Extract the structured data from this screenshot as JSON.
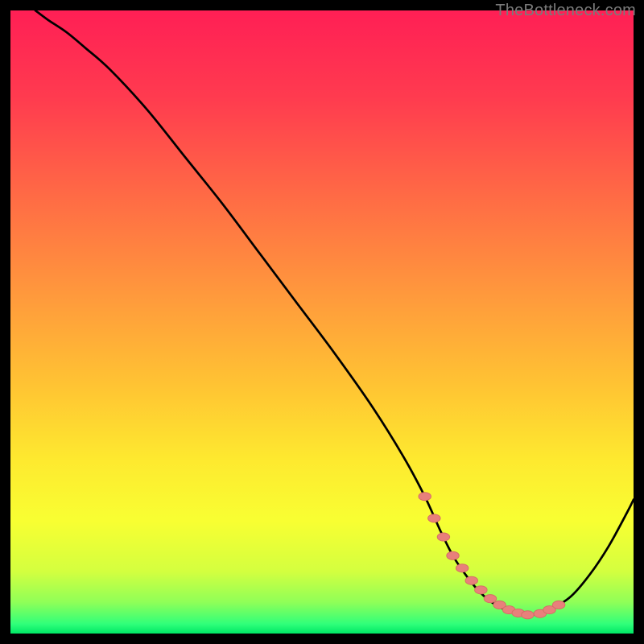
{
  "watermark": "TheBottleneck.com",
  "colors": {
    "background": "#000000",
    "curve": "#000000",
    "marker_fill": "#e8807b",
    "marker_stroke": "#d66b66",
    "gradient_stops": [
      {
        "offset": 0.0,
        "color": "#ff1f55"
      },
      {
        "offset": 0.14,
        "color": "#ff3b4f"
      },
      {
        "offset": 0.3,
        "color": "#ff6b45"
      },
      {
        "offset": 0.46,
        "color": "#ff9a3c"
      },
      {
        "offset": 0.6,
        "color": "#ffc333"
      },
      {
        "offset": 0.72,
        "color": "#fee92f"
      },
      {
        "offset": 0.82,
        "color": "#f8ff32"
      },
      {
        "offset": 0.9,
        "color": "#d4ff3f"
      },
      {
        "offset": 0.95,
        "color": "#8fff58"
      },
      {
        "offset": 0.985,
        "color": "#2fff7a"
      },
      {
        "offset": 1.0,
        "color": "#00e765"
      }
    ]
  },
  "chart_data": {
    "type": "line",
    "title": "",
    "xlabel": "",
    "ylabel": "",
    "xlim": [
      0,
      100
    ],
    "ylim": [
      0,
      100
    ],
    "series": [
      {
        "name": "bottleneck-curve",
        "x": [
          4,
          6,
          9,
          12,
          16,
          22,
          28,
          34,
          40,
          46,
          52,
          58,
          63,
          66.5,
          69,
          71,
          73,
          75,
          77,
          79,
          81,
          83,
          85,
          87,
          90,
          93,
          96,
          99,
          100
        ],
        "y": [
          100,
          98.5,
          96.5,
          94,
          90.5,
          84,
          76.5,
          69,
          61,
          53,
          45,
          36.5,
          28.5,
          22,
          16.5,
          12.5,
          9.5,
          7,
          5.2,
          4,
          3.3,
          3,
          3.2,
          4,
          6,
          9.5,
          14,
          19.5,
          21.5
        ]
      }
    ],
    "markers": {
      "name": "highlighted-range",
      "x": [
        66.5,
        68,
        69.5,
        71,
        72.5,
        74,
        75.5,
        77,
        78.5,
        80,
        81.5,
        83,
        85,
        86.5,
        88
      ],
      "y": [
        22,
        18.5,
        15.5,
        12.5,
        10.5,
        8.5,
        7,
        5.6,
        4.6,
        3.8,
        3.3,
        3,
        3.2,
        3.8,
        4.6
      ]
    }
  }
}
